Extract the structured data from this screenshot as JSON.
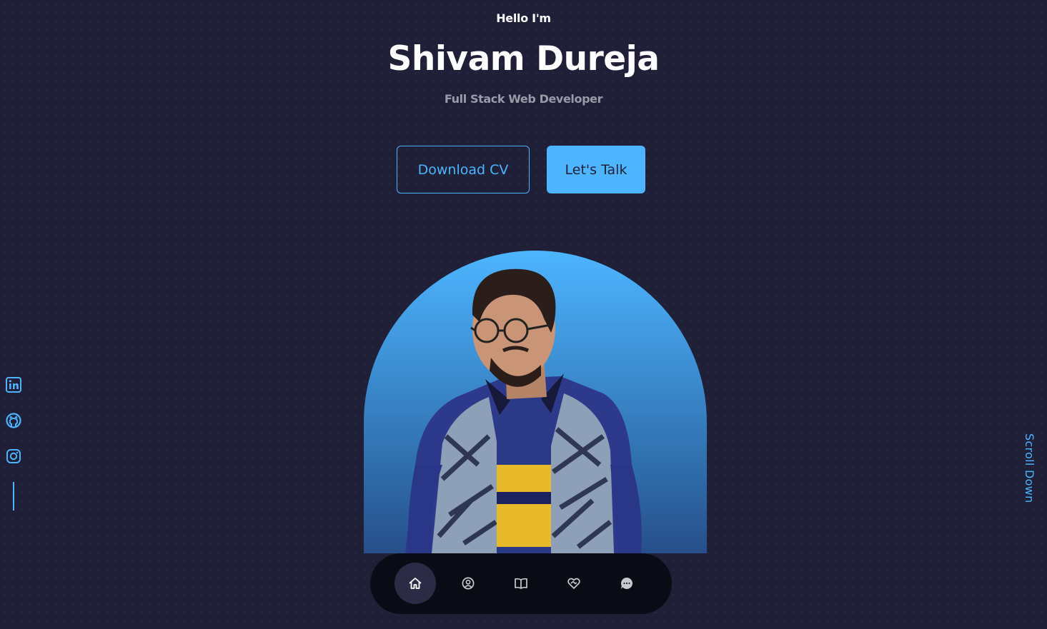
{
  "header": {
    "greeting": "Hello I'm",
    "name": "Shivam Dureja",
    "role": "Full Stack Web Developer"
  },
  "cta": {
    "download_label": "Download CV",
    "talk_label": "Let's Talk"
  },
  "socials": [
    {
      "icon": "linkedin-icon"
    },
    {
      "icon": "github-icon"
    },
    {
      "icon": "instagram-icon"
    }
  ],
  "scroll": {
    "label": "Scroll Down"
  },
  "nav": {
    "items": [
      {
        "icon": "home-icon",
        "active": true
      },
      {
        "icon": "user-icon",
        "active": false
      },
      {
        "icon": "book-icon",
        "active": false
      },
      {
        "icon": "handshake-icon",
        "active": false
      },
      {
        "icon": "message-icon",
        "active": false
      }
    ]
  },
  "colors": {
    "background": "#1f1f38",
    "accent": "#4db5ff",
    "nav_background": "#0b0b16",
    "nav_active": "#2b2b45",
    "muted_text": "#9a9aa8"
  }
}
